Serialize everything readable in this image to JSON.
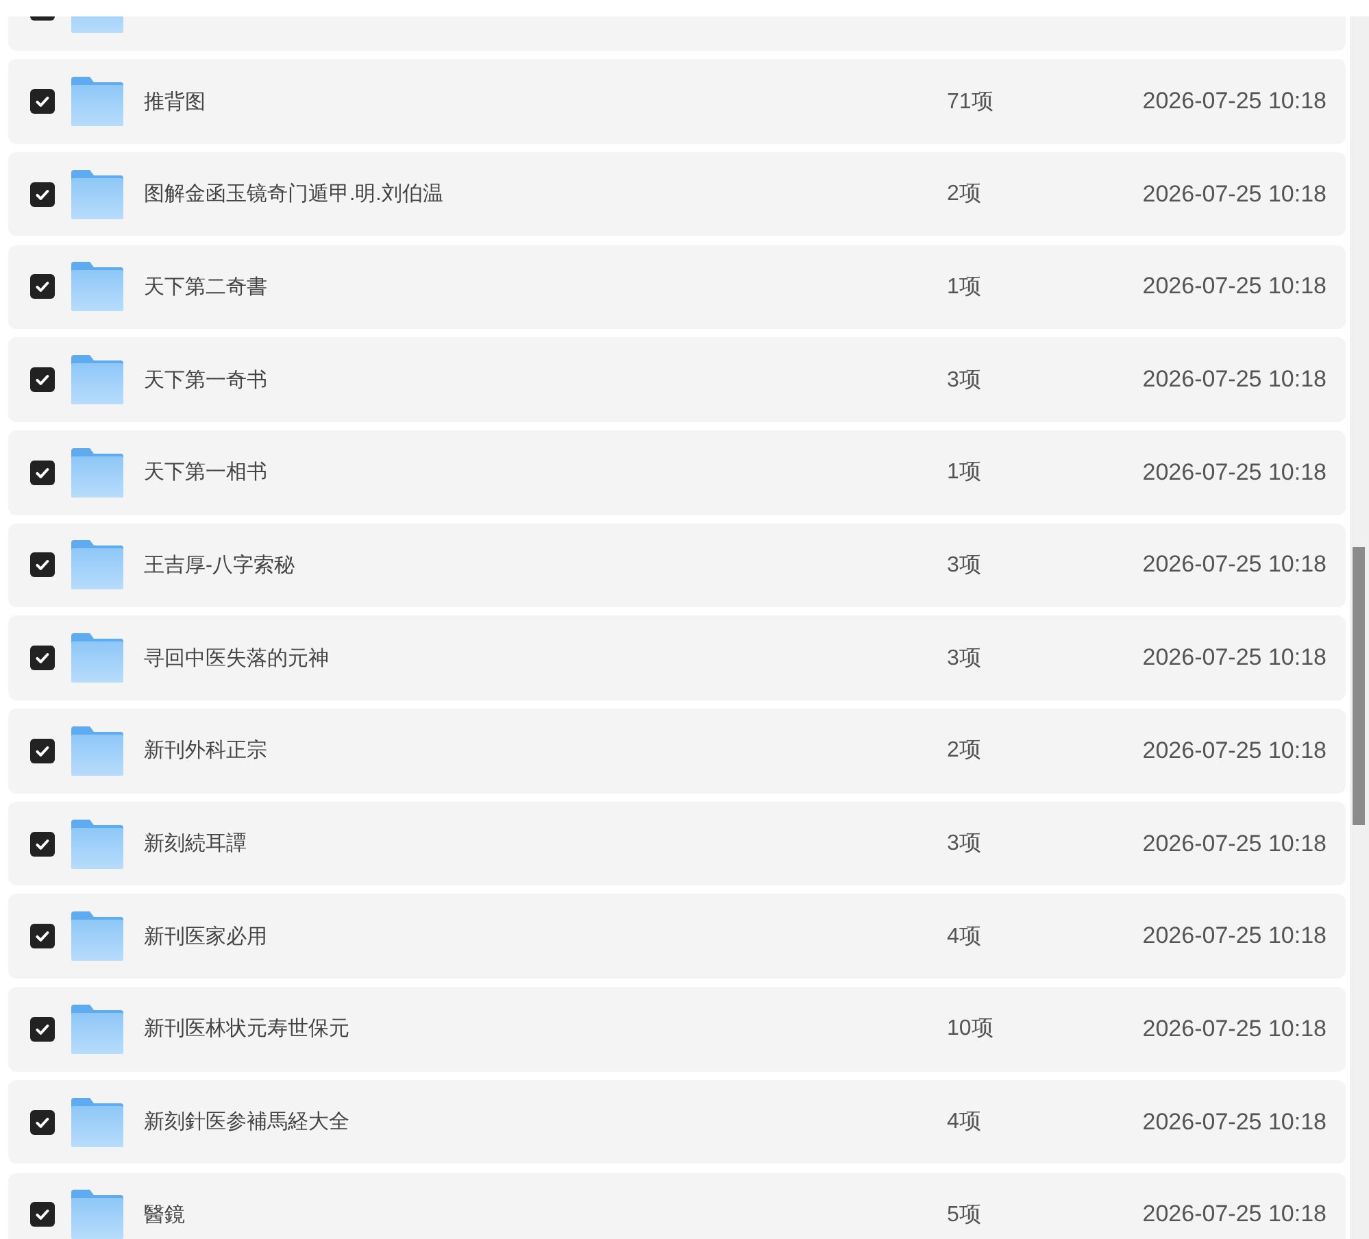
{
  "file_list": {
    "rows": [
      {
        "checked": true
      },
      {
        "checked": true,
        "name": "推背图",
        "count": "71项",
        "modified": "2026-07-25 10:18"
      },
      {
        "checked": true,
        "name": "图解金函玉镜奇门遁甲.明.刘伯温",
        "count": "2项",
        "modified": "2026-07-25 10:18"
      },
      {
        "checked": true,
        "name": "天下第二奇書",
        "count": "1项",
        "modified": "2026-07-25 10:18"
      },
      {
        "checked": true,
        "name": "天下第一奇书",
        "count": "3项",
        "modified": "2026-07-25 10:18"
      },
      {
        "checked": true,
        "name": "天下第一相书",
        "count": "1项",
        "modified": "2026-07-25 10:18"
      },
      {
        "checked": true,
        "name": "王吉厚-八字索秘",
        "count": "3项",
        "modified": "2026-07-25 10:18"
      },
      {
        "checked": true,
        "name": "寻回中医失落的元神",
        "count": "3项",
        "modified": "2026-07-25 10:18"
      },
      {
        "checked": true,
        "name": "新刊外科正宗",
        "count": "2项",
        "modified": "2026-07-25 10:18"
      },
      {
        "checked": true,
        "name": "新刻続耳譚",
        "count": "3项",
        "modified": "2026-07-25 10:18"
      },
      {
        "checked": true,
        "name": "新刊医家必用",
        "count": "4项",
        "modified": "2026-07-25 10:18"
      },
      {
        "checked": true,
        "name": "新刊医林状元寿世保元",
        "count": "10项",
        "modified": "2026-07-25 10:18"
      },
      {
        "checked": true,
        "name": "新刻針医参補馬経大全",
        "count": "4项",
        "modified": "2026-07-25 10:18"
      },
      {
        "checked": true,
        "name": "醫鏡",
        "count": "5项",
        "modified": "2026-07-25 10:18"
      }
    ]
  }
}
